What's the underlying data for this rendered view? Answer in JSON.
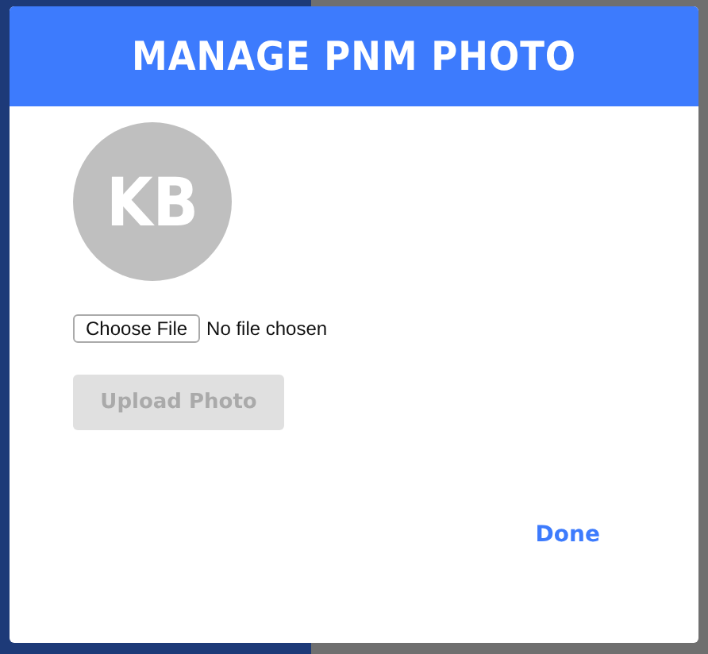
{
  "dialog": {
    "title": "MANAGE PNM PHOTO",
    "avatar_initials": "KB",
    "file_picker": {
      "button": "Choose File",
      "status": "No file chosen"
    },
    "upload_button": {
      "label": "Upload Photo",
      "disabled": true
    },
    "done_button": "Done"
  }
}
